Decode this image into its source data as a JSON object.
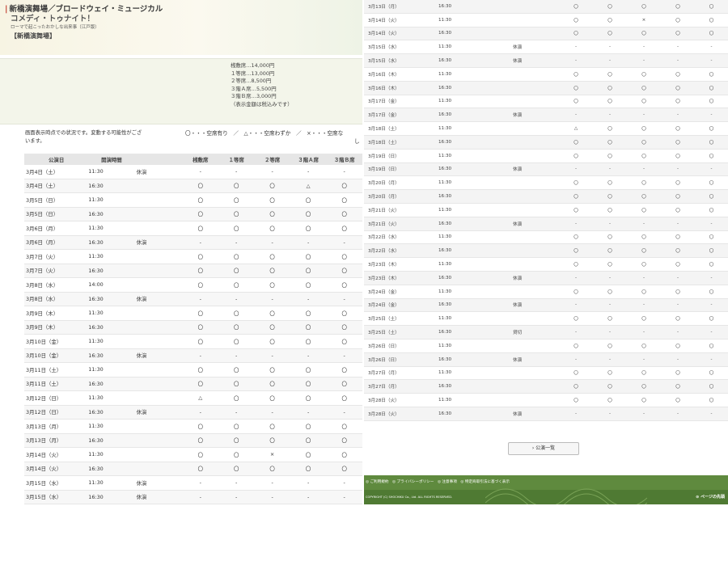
{
  "left": {
    "header": {
      "title": "新橋演舞場／ブロードウェイ・ミュージカル",
      "subtitle": "コメディ・トゥナイト！",
      "small": "ローマで起こったおかしな出来事（江戸版）",
      "venue": "【新橋演舞場】"
    },
    "prices": [
      "桟敷席…14,000円",
      "１等席…13,000円",
      "２等席…8,500円",
      "３階Ａ席…5,500円",
      "３階Ｂ席…3,000円",
      "（表示金額は税込みです）"
    ],
    "note": "画面表示時点での状況です。変動する可能性がございます。",
    "legend": "〇・・・空席有り　／　△・・・空席わずか　／　×・・・空席な",
    "legend2": "し",
    "columns": [
      "公演日",
      "開演時間",
      "",
      "桟敷席",
      "１等席",
      "２等席",
      "３階Ａ席",
      "３階Ｂ席"
    ],
    "rows": [
      [
        "3月4日（土）",
        "11:30",
        "休演",
        "-",
        "-",
        "-",
        "-",
        "-"
      ],
      [
        "3月4日（土）",
        "16:30",
        "",
        "〇",
        "〇",
        "〇",
        "△",
        "〇"
      ],
      [
        "3月5日（日）",
        "11:30",
        "",
        "〇",
        "〇",
        "〇",
        "〇",
        "〇"
      ],
      [
        "3月5日（日）",
        "16:30",
        "",
        "〇",
        "〇",
        "〇",
        "〇",
        "〇"
      ],
      [
        "3月6日（月）",
        "11:30",
        "",
        "〇",
        "〇",
        "〇",
        "〇",
        "〇"
      ],
      [
        "3月6日（月）",
        "16:30",
        "休演",
        "-",
        "-",
        "-",
        "-",
        "-"
      ],
      [
        "3月7日（火）",
        "11:30",
        "",
        "〇",
        "〇",
        "〇",
        "〇",
        "〇"
      ],
      [
        "3月7日（火）",
        "16:30",
        "",
        "〇",
        "〇",
        "〇",
        "〇",
        "〇"
      ],
      [
        "3月8日（水）",
        "14:00",
        "",
        "〇",
        "〇",
        "〇",
        "〇",
        "〇"
      ],
      [
        "3月8日（水）",
        "16:30",
        "休演",
        "-",
        "-",
        "-",
        "-",
        "-"
      ],
      [
        "3月9日（木）",
        "11:30",
        "",
        "〇",
        "〇",
        "〇",
        "〇",
        "〇"
      ],
      [
        "3月9日（木）",
        "16:30",
        "",
        "〇",
        "〇",
        "〇",
        "〇",
        "〇"
      ],
      [
        "3月10日（金）",
        "11:30",
        "",
        "〇",
        "〇",
        "〇",
        "〇",
        "〇"
      ],
      [
        "3月10日（金）",
        "16:30",
        "休演",
        "-",
        "-",
        "-",
        "-",
        "-"
      ],
      [
        "3月11日（土）",
        "11:30",
        "",
        "〇",
        "〇",
        "〇",
        "〇",
        "〇"
      ],
      [
        "3月11日（土）",
        "16:30",
        "",
        "〇",
        "〇",
        "〇",
        "〇",
        "〇"
      ],
      [
        "3月12日（日）",
        "11:30",
        "",
        "△",
        "〇",
        "〇",
        "〇",
        "〇"
      ],
      [
        "3月12日（日）",
        "16:30",
        "休演",
        "-",
        "-",
        "-",
        "-",
        "-"
      ],
      [
        "3月13日（月）",
        "11:30",
        "",
        "〇",
        "〇",
        "〇",
        "〇",
        "〇"
      ],
      [
        "3月13日（月）",
        "16:30",
        "",
        "〇",
        "〇",
        "〇",
        "〇",
        "〇"
      ],
      [
        "3月14日（火）",
        "11:30",
        "",
        "〇",
        "〇",
        "×",
        "〇",
        "〇"
      ],
      [
        "3月14日（火）",
        "16:30",
        "",
        "〇",
        "〇",
        "〇",
        "〇",
        "〇"
      ],
      [
        "3月15日（水）",
        "11:30",
        "休演",
        "-",
        "-",
        "-",
        "-",
        "-"
      ],
      [
        "3月15日（水）",
        "16:30",
        "休演",
        "-",
        "-",
        "-",
        "-",
        "-"
      ]
    ]
  },
  "right": {
    "rows": [
      [
        "3月13日（月）",
        "16:30",
        "",
        "〇",
        "〇",
        "〇",
        "〇",
        "〇"
      ],
      [
        "3月14日（火）",
        "11:30",
        "",
        "〇",
        "〇",
        "×",
        "〇",
        "〇"
      ],
      [
        "3月14日（火）",
        "16:30",
        "",
        "〇",
        "〇",
        "〇",
        "〇",
        "〇"
      ],
      [
        "3月15日（水）",
        "11:30",
        "休演",
        "-",
        "-",
        "-",
        "-",
        "-"
      ],
      [
        "3月15日（水）",
        "16:30",
        "休演",
        "-",
        "-",
        "-",
        "-",
        "-"
      ],
      [
        "3月16日（木）",
        "11:30",
        "",
        "〇",
        "〇",
        "〇",
        "〇",
        "〇"
      ],
      [
        "3月16日（木）",
        "16:30",
        "",
        "〇",
        "〇",
        "〇",
        "〇",
        "〇"
      ],
      [
        "3月17日（金）",
        "11:30",
        "",
        "〇",
        "〇",
        "〇",
        "〇",
        "〇"
      ],
      [
        "3月17日（金）",
        "16:30",
        "休演",
        "-",
        "-",
        "-",
        "-",
        "-"
      ],
      [
        "3月18日（土）",
        "11:30",
        "",
        "△",
        "〇",
        "〇",
        "〇",
        "〇"
      ],
      [
        "3月18日（土）",
        "16:30",
        "",
        "〇",
        "〇",
        "〇",
        "〇",
        "〇"
      ],
      [
        "3月19日（日）",
        "11:30",
        "",
        "〇",
        "〇",
        "〇",
        "〇",
        "〇"
      ],
      [
        "3月19日（日）",
        "16:30",
        "休演",
        "-",
        "-",
        "-",
        "-",
        "-"
      ],
      [
        "3月20日（月）",
        "11:30",
        "",
        "〇",
        "〇",
        "〇",
        "〇",
        "〇"
      ],
      [
        "3月20日（月）",
        "16:30",
        "",
        "〇",
        "〇",
        "〇",
        "〇",
        "〇"
      ],
      [
        "3月21日（火）",
        "11:30",
        "",
        "〇",
        "〇",
        "〇",
        "〇",
        "〇"
      ],
      [
        "3月21日（火）",
        "16:30",
        "休演",
        "-",
        "-",
        "-",
        "-",
        "-"
      ],
      [
        "3月22日（水）",
        "11:30",
        "",
        "〇",
        "〇",
        "〇",
        "〇",
        "〇"
      ],
      [
        "3月22日（水）",
        "16:30",
        "",
        "〇",
        "〇",
        "〇",
        "〇",
        "〇"
      ],
      [
        "3月23日（木）",
        "11:30",
        "",
        "〇",
        "〇",
        "〇",
        "〇",
        "〇"
      ],
      [
        "3月23日（木）",
        "16:30",
        "休演",
        "-",
        "-",
        "-",
        "-",
        "-"
      ],
      [
        "3月24日（金）",
        "11:30",
        "",
        "〇",
        "〇",
        "〇",
        "〇",
        "〇"
      ],
      [
        "3月24日（金）",
        "16:30",
        "休演",
        "-",
        "-",
        "-",
        "-",
        "-"
      ],
      [
        "3月25日（土）",
        "11:30",
        "",
        "〇",
        "〇",
        "〇",
        "〇",
        "〇"
      ],
      [
        "3月25日（土）",
        "16:30",
        "貸切",
        "-",
        "-",
        "-",
        "-",
        "-"
      ],
      [
        "3月26日（日）",
        "11:30",
        "",
        "〇",
        "〇",
        "〇",
        "〇",
        "〇"
      ],
      [
        "3月26日（日）",
        "16:30",
        "休演",
        "-",
        "-",
        "-",
        "-",
        "-"
      ],
      [
        "3月27日（月）",
        "11:30",
        "",
        "〇",
        "〇",
        "〇",
        "〇",
        "〇"
      ],
      [
        "3月27日（月）",
        "16:30",
        "",
        "〇",
        "〇",
        "〇",
        "〇",
        "〇"
      ],
      [
        "3月28日（火）",
        "11:30",
        "",
        "〇",
        "〇",
        "〇",
        "〇",
        "〇"
      ],
      [
        "3月28日（火）",
        "16:30",
        "休演",
        "-",
        "-",
        "-",
        "-",
        "-"
      ]
    ],
    "button_label": "› 公演一覧",
    "footer_links": "◎ ご利用規約　◎ プライバシーポリシー　◎ 注意事項　◎ 特定商取引法に基づく表示",
    "copyright": "COPYRIGHT (C) SHOCHIKU Co., Ltd. ALL RIGHTS RESERVED.",
    "page_top": "⊙ ページの先頭"
  }
}
